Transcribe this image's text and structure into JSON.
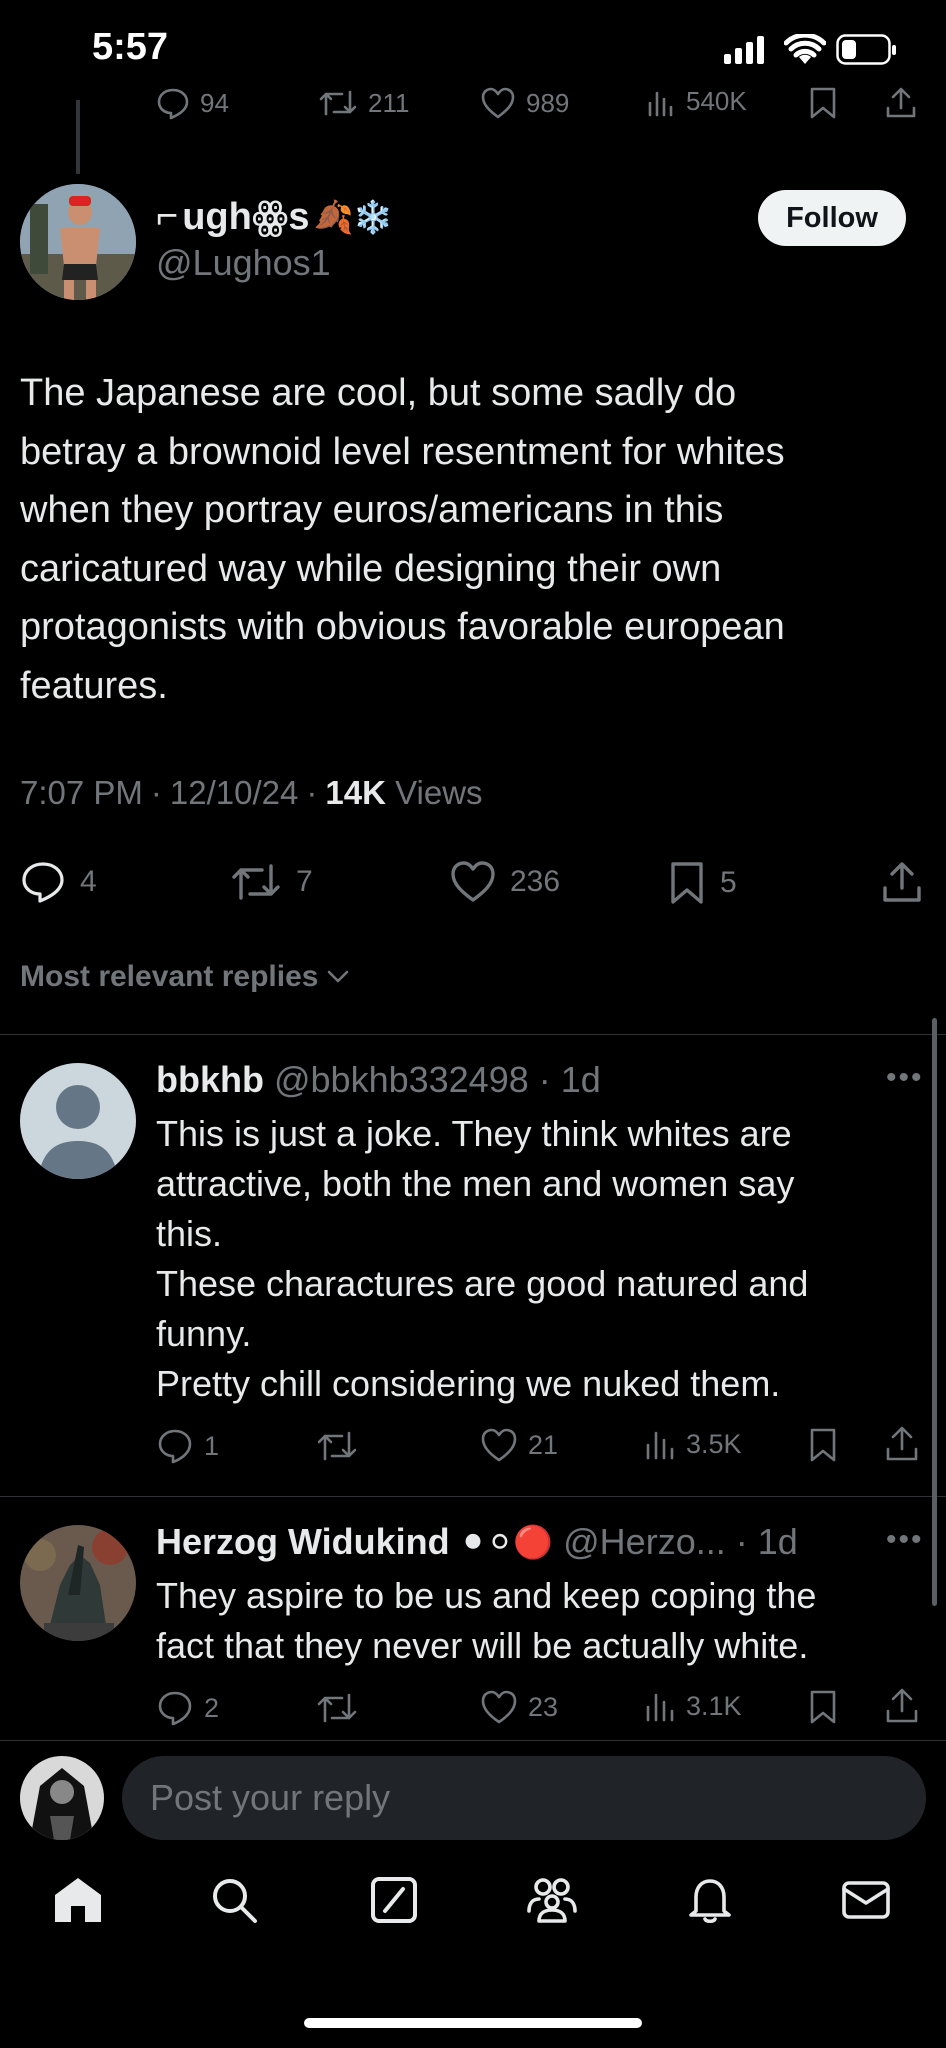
{
  "status_bar": {
    "time": "5:57"
  },
  "prev_actions": {
    "replies": "94",
    "reposts": "211",
    "likes": "989",
    "views": "540K"
  },
  "author": {
    "name": "ughꙮs",
    "name_emoji": "🍂❄️",
    "handle": "@Lughos1",
    "follow_label": "Follow"
  },
  "post": {
    "text": "The Japanese are cool, but some sadly do\nbetray a brownoid level resentment for whites\nwhen they portray euros/americans in this\ncaricatured way while designing their own\nprotagonists with obvious favorable european\nfeatures.",
    "time": "7:07 PM",
    "date": "12/10/24",
    "views_count": "14K",
    "views_label": "Views",
    "replies": "4",
    "reposts": "7",
    "likes": "236",
    "bookmarks": "5"
  },
  "replies_header": "Most relevant replies",
  "replies": [
    {
      "name": "bbkhb",
      "handle": "@bbkhb332498",
      "age": "1d",
      "text": "This is just a joke. They think whites are\nattractive, both the men and women say\nthis.\nThese charactures are good natured and\nfunny.\nPretty chill considering we nuked them.",
      "replies": "1",
      "likes": "21",
      "views": "3.5K"
    },
    {
      "name": "Herzog Widukind",
      "name_emoji": "⚫⚪🔴",
      "handle": "@Herzo...",
      "age": "1d",
      "text": "They aspire to be us and keep coping the\nfact that they never will be actually white.",
      "replies": "2",
      "likes": "23",
      "views": "3.1K"
    }
  ],
  "composer": {
    "placeholder": "Post your reply"
  },
  "colors": {
    "background": "#000000",
    "text": "#e7e9ea",
    "muted": "#71767b",
    "divider": "#2f3336"
  }
}
